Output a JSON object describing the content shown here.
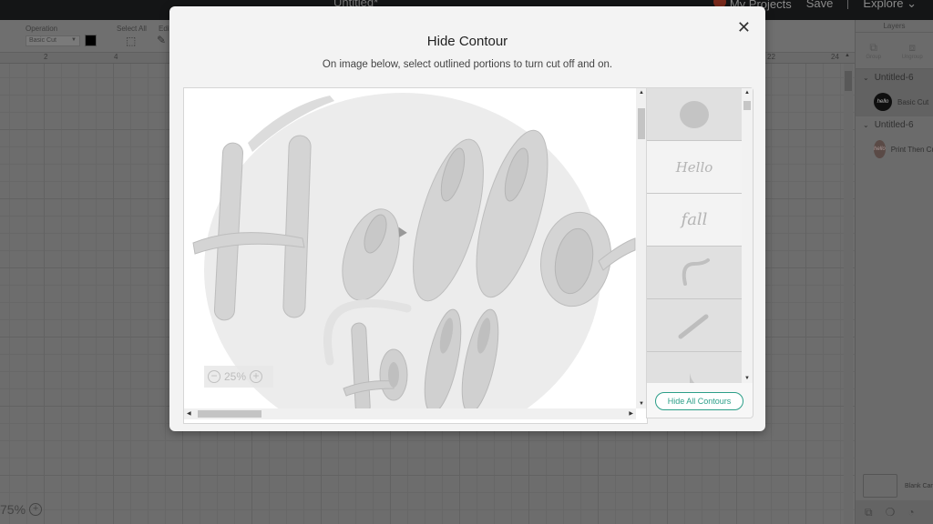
{
  "topbar": {
    "doc_title": "Untitled*",
    "my_projects": "My Projects",
    "save": "Save",
    "explore": "Explore"
  },
  "toolbar": {
    "operation_label": "Operation",
    "operation_value": "Basic Cut",
    "operation_color": "#000000",
    "select_all_label": "Select All",
    "edit_label": "Edit"
  },
  "ruler": {
    "ticks": [
      "2",
      "4",
      "22",
      "24"
    ]
  },
  "canvas": {
    "zoom_level": "75%"
  },
  "layers": {
    "header": "Layers",
    "group_label": "Group",
    "ungroup_label": "Ungroup",
    "groups": [
      {
        "title": "Untitled-6",
        "item_label": "Basic Cut",
        "thumb_text": "hello",
        "selected": true
      },
      {
        "title": "Untitled-6",
        "item_label": "Print Then Cut",
        "thumb_text": "hello",
        "selected": false
      }
    ],
    "blank_canvas_label": "Blank Canvas"
  },
  "modal": {
    "title": "Hide Contour",
    "subtitle": "On image below, select outlined portions to turn cut off and on.",
    "preview_zoom": "25%",
    "preview_text_line1": "Hello",
    "preview_text_line2": "Fall",
    "contours": [
      {
        "name": "circle-background",
        "label": "",
        "visible": false
      },
      {
        "name": "hello-text",
        "label": "Hello",
        "visible": true
      },
      {
        "name": "fall-text",
        "label": "fall",
        "visible": true
      },
      {
        "name": "swoosh-stroke",
        "label": "",
        "visible": false
      },
      {
        "name": "diagonal-stroke",
        "label": "",
        "visible": false
      },
      {
        "name": "leaf-shape",
        "label": "",
        "visible": false
      }
    ],
    "hide_all_label": "Hide All Contours",
    "accent_color": "#2b9e88"
  }
}
